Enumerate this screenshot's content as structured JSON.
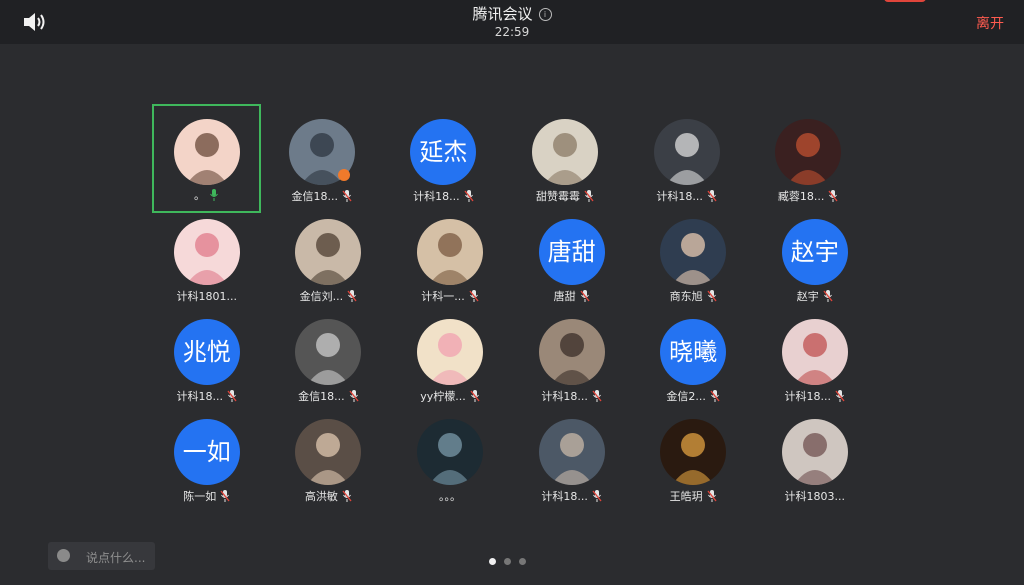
{
  "header": {
    "title": "腾讯会议",
    "time": "22:59",
    "leave_label": "离开"
  },
  "chat": {
    "placeholder": "说点什么..."
  },
  "pagination": {
    "pages": 3,
    "current": 1
  },
  "colors": {
    "accent_blue": "#2473f2",
    "leave_red": "#ff5b4f",
    "active_green": "#3fb85c"
  },
  "participants": [
    [
      {
        "name": "。",
        "avatar": "photo",
        "mic": "on",
        "active": true
      },
      {
        "name": "金信18...",
        "avatar": "photo",
        "mic": "muted",
        "badge": true
      },
      {
        "name": "计科18...",
        "avatar_text": "延杰",
        "mic": "muted"
      },
      {
        "name": "甜赞霉霉",
        "avatar": "photo",
        "mic": "muted"
      },
      {
        "name": "计科18...",
        "avatar": "photo",
        "mic": "muted"
      },
      {
        "name": "臧蓉18...",
        "avatar": "photo",
        "mic": "muted"
      }
    ],
    [
      {
        "name": "计科1801...",
        "avatar": "photo",
        "mic": "none"
      },
      {
        "name": "金信刘...",
        "avatar": "photo",
        "mic": "muted"
      },
      {
        "name": "计科一...",
        "avatar": "photo",
        "mic": "muted"
      },
      {
        "name": "唐甜",
        "avatar_text": "唐甜",
        "mic": "muted"
      },
      {
        "name": "商东旭",
        "avatar": "photo",
        "mic": "muted"
      },
      {
        "name": "赵宇",
        "avatar_text": "赵宇",
        "mic": "muted"
      }
    ],
    [
      {
        "name": "计科18...",
        "avatar_text": "兆悦",
        "mic": "muted"
      },
      {
        "name": "金信18...",
        "avatar": "photo",
        "mic": "muted"
      },
      {
        "name": "yy柠檬...",
        "avatar": "photo",
        "mic": "muted"
      },
      {
        "name": "计科18...",
        "avatar": "photo",
        "mic": "muted"
      },
      {
        "name": "金信2...",
        "avatar_text": "晓曦",
        "mic": "muted"
      },
      {
        "name": "计科18...",
        "avatar": "photo",
        "mic": "muted"
      }
    ],
    [
      {
        "name": "陈一如",
        "avatar_text": "一如",
        "mic": "muted"
      },
      {
        "name": "高洪敏",
        "avatar": "photo",
        "mic": "muted"
      },
      {
        "name": "。。。",
        "avatar": "photo",
        "mic": "none"
      },
      {
        "name": "计科18...",
        "avatar": "photo",
        "mic": "muted"
      },
      {
        "name": "王皓玥",
        "avatar": "photo",
        "mic": "muted"
      },
      {
        "name": "计科1803...",
        "avatar": "photo",
        "mic": "none"
      }
    ]
  ]
}
